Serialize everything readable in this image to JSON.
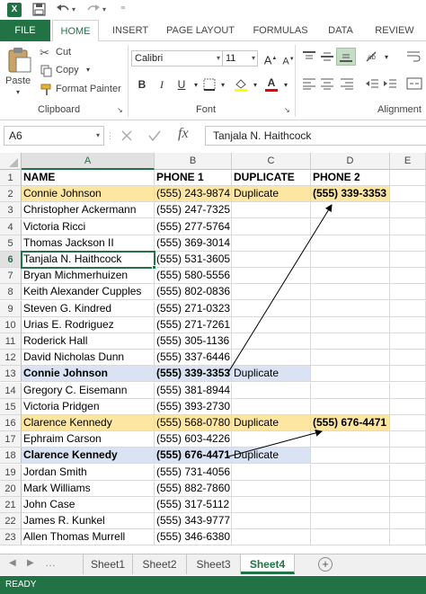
{
  "ribbon_tabs": [
    {
      "label": "FILE"
    },
    {
      "label": "HOME"
    },
    {
      "label": "INSERT"
    },
    {
      "label": "PAGE LAYOUT"
    },
    {
      "label": "FORMULAS"
    },
    {
      "label": "DATA"
    },
    {
      "label": "REVIEW"
    }
  ],
  "clipboard": {
    "paste_label": "Paste",
    "cut_label": "Cut",
    "copy_label": "Copy",
    "format_painter_label": "Format Painter",
    "group_label": "Clipboard"
  },
  "font": {
    "name": "Calibri",
    "size": "11",
    "group_label": "Font"
  },
  "alignment": {
    "group_label": "Alignment"
  },
  "formula_bar": {
    "name_box": "A6",
    "fx": "fx",
    "formula": "Tanjala N. Haithcock"
  },
  "columns": [
    "A",
    "B",
    "C",
    "D",
    "E"
  ],
  "rows": [
    {
      "num": "1",
      "a": "NAME",
      "b": "PHONE 1",
      "c": "DUPLICATE",
      "d": "PHONE 2",
      "style": "header"
    },
    {
      "num": "2",
      "a": "Connie Johnson",
      "b": "(555) 243-9874",
      "c": "Duplicate",
      "d": "(555) 339-3353",
      "style": "orange"
    },
    {
      "num": "3",
      "a": "Christopher Ackermann",
      "b": "(555) 247-7325",
      "c": "",
      "d": "",
      "style": ""
    },
    {
      "num": "4",
      "a": "Victoria Ricci",
      "b": "(555) 277-5764",
      "c": "",
      "d": "",
      "style": ""
    },
    {
      "num": "5",
      "a": "Thomas Jackson II",
      "b": "(555) 369-3014",
      "c": "",
      "d": "",
      "style": ""
    },
    {
      "num": "6",
      "a": "Tanjala N. Haithcock",
      "b": "(555) 531-3605",
      "c": "",
      "d": "",
      "style": ""
    },
    {
      "num": "7",
      "a": "Bryan Michmerhuizen",
      "b": "(555) 580-5556",
      "c": "",
      "d": "",
      "style": ""
    },
    {
      "num": "8",
      "a": "Keith Alexander Cupples",
      "b": "(555) 802-0836",
      "c": "",
      "d": "",
      "style": ""
    },
    {
      "num": "9",
      "a": "Steven G. Kindred",
      "b": "(555) 271-0323",
      "c": "",
      "d": "",
      "style": ""
    },
    {
      "num": "10",
      "a": "Urias E. Rodriguez",
      "b": "(555) 271-7261",
      "c": "",
      "d": "",
      "style": ""
    },
    {
      "num": "11",
      "a": "Roderick Hall",
      "b": "(555) 305-1136",
      "c": "",
      "d": "",
      "style": ""
    },
    {
      "num": "12",
      "a": "David Nicholas Dunn",
      "b": "(555) 337-6446",
      "c": "",
      "d": "",
      "style": ""
    },
    {
      "num": "13",
      "a": "Connie Johnson",
      "b": "(555) 339-3353",
      "c": "Duplicate",
      "d": "",
      "style": "blue"
    },
    {
      "num": "14",
      "a": "Gregory C. Eisemann",
      "b": "(555) 381-8944",
      "c": "",
      "d": "",
      "style": ""
    },
    {
      "num": "15",
      "a": "Victoria Pridgen",
      "b": "(555) 393-2730",
      "c": "",
      "d": "",
      "style": ""
    },
    {
      "num": "16",
      "a": "Clarence Kennedy",
      "b": "(555) 568-0780",
      "c": "Duplicate",
      "d": "(555) 676-4471",
      "style": "orange"
    },
    {
      "num": "17",
      "a": "Ephraim Carson",
      "b": "(555) 603-4226",
      "c": "",
      "d": "",
      "style": ""
    },
    {
      "num": "18",
      "a": "Clarence Kennedy",
      "b": "(555) 676-4471",
      "c": "Duplicate",
      "d": "",
      "style": "blue"
    },
    {
      "num": "19",
      "a": "Jordan Smith",
      "b": "(555) 731-4056",
      "c": "",
      "d": "",
      "style": ""
    },
    {
      "num": "20",
      "a": "Mark Williams",
      "b": "(555) 882-7860",
      "c": "",
      "d": "",
      "style": ""
    },
    {
      "num": "21",
      "a": "John Case",
      "b": "(555) 317-5112",
      "c": "",
      "d": "",
      "style": ""
    },
    {
      "num": "22",
      "a": "James R. Kunkel",
      "b": "(555) 343-9777",
      "c": "",
      "d": "",
      "style": ""
    },
    {
      "num": "23",
      "a": "Allen Thomas Murrell",
      "b": "(555) 346-6380",
      "c": "",
      "d": "",
      "style": ""
    }
  ],
  "selected_cell": "A6",
  "sheet_tabs": [
    {
      "label": "Sheet1",
      "active": false
    },
    {
      "label": "Sheet2",
      "active": false
    },
    {
      "label": "Sheet3",
      "active": false
    },
    {
      "label": "Sheet4",
      "active": true
    }
  ],
  "status": "READY",
  "colors": {
    "excel_green": "#217346",
    "highlight_orange": "#fde6a1",
    "highlight_blue": "#dae3f3"
  }
}
